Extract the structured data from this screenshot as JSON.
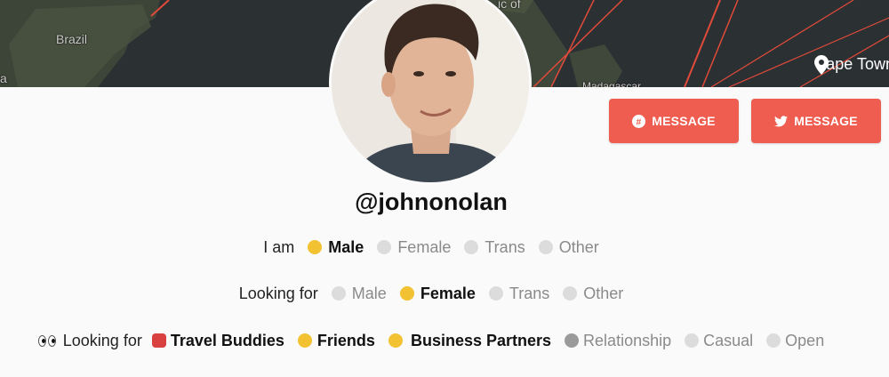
{
  "map": {
    "labels": [
      "Brazil",
      "a",
      "ic of",
      "Madagascar"
    ],
    "location": "Cape Town"
  },
  "buttons": [
    {
      "label": "MESSAGE",
      "icon": "slack-icon"
    },
    {
      "label": "MESSAGE",
      "icon": "twitter-icon"
    }
  ],
  "profile": {
    "handle": "@johnonolan"
  },
  "i_am": {
    "prefix": "I am",
    "options": [
      {
        "label": "Male",
        "selected": true
      },
      {
        "label": "Female",
        "selected": false
      },
      {
        "label": "Trans",
        "selected": false
      },
      {
        "label": "Other",
        "selected": false
      }
    ]
  },
  "looking_for_gender": {
    "prefix": "Looking for",
    "options": [
      {
        "label": "Male",
        "selected": false
      },
      {
        "label": "Female",
        "selected": true
      },
      {
        "label": "Trans",
        "selected": false
      },
      {
        "label": "Other",
        "selected": false
      }
    ]
  },
  "looking_for_type": {
    "prefix": "Looking for",
    "options": [
      {
        "label": "Travel Buddies",
        "selected": true
      },
      {
        "label": "Friends",
        "selected": true
      },
      {
        "label": "Business Partners",
        "selected": true
      },
      {
        "label": "Relationship",
        "selected": false
      },
      {
        "label": "Casual",
        "selected": false
      },
      {
        "label": "Open",
        "selected": false
      }
    ]
  },
  "colors": {
    "accent": "#ee5d4f",
    "map_bg": "#2b3033"
  }
}
